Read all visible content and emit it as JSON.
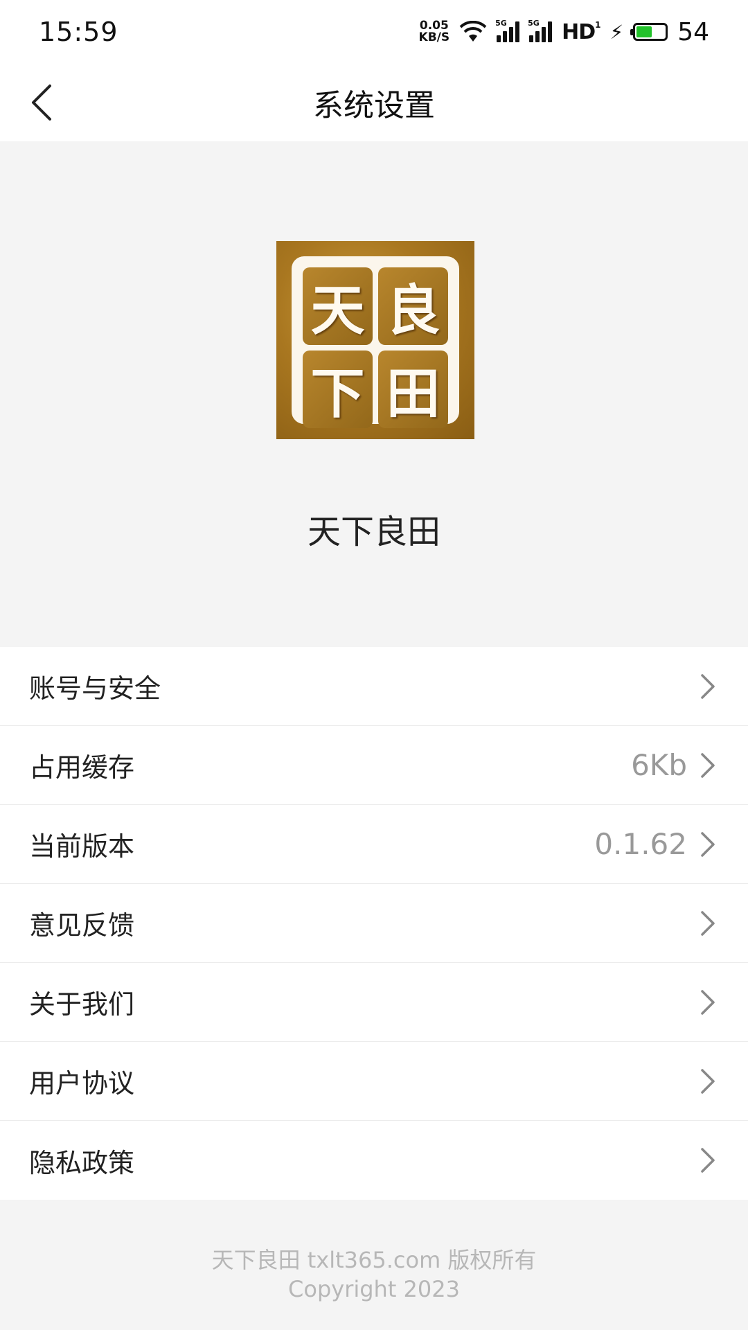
{
  "status_bar": {
    "time": "15:59",
    "net_speed_value": "0.05",
    "net_speed_unit": "KB/S",
    "signal1_tag": "5G",
    "signal2_tag": "5G",
    "hd_label": "HD",
    "hd_sub": "1",
    "battery_level": 54,
    "battery_text": "54",
    "battery_color": "#22c22a"
  },
  "nav": {
    "title": "系统设置",
    "back_icon": "chevron-left-icon"
  },
  "app": {
    "logo_chars": [
      "天",
      "良",
      "下",
      "田"
    ],
    "name": "天下良田"
  },
  "settings": {
    "items": [
      {
        "label": "账号与安全",
        "value": ""
      },
      {
        "label": "占用缓存",
        "value": "6Kb"
      },
      {
        "label": "当前版本",
        "value": "0.1.62"
      },
      {
        "label": "意见反馈",
        "value": ""
      },
      {
        "label": "关于我们",
        "value": ""
      },
      {
        "label": "用户协议",
        "value": ""
      },
      {
        "label": "隐私政策",
        "value": ""
      }
    ]
  },
  "footer": {
    "line1": "天下良田 txlt365.com 版权所有",
    "line2": "Copyright 2023"
  }
}
